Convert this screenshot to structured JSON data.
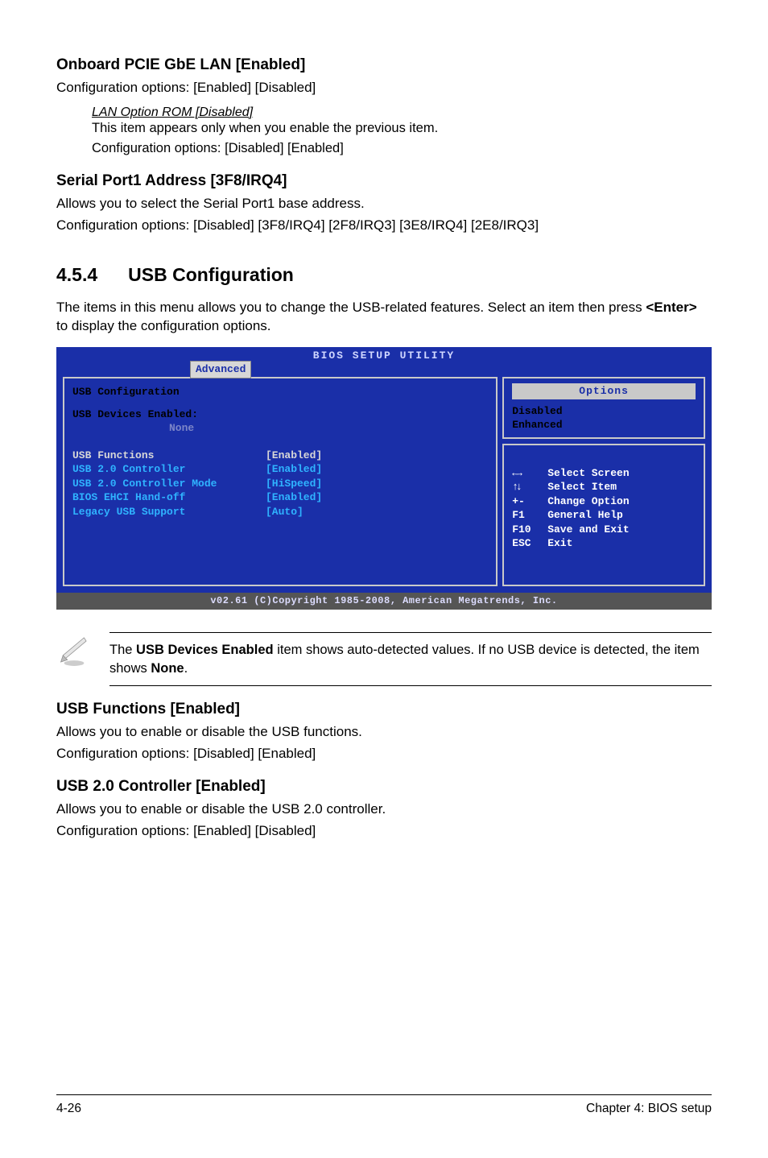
{
  "h_onboard": "Onboard PCIE GbE LAN [Enabled]",
  "h_onboard_opts": "Configuration options: [Enabled] [Disabled]",
  "lan_rom": {
    "title": "LAN Option ROM [Disabled]",
    "line1": "This item appears only when you enable the previous item.",
    "line2": "Configuration options: [Disabled] [Enabled]"
  },
  "h_serial": "Serial Port1 Address [3F8/IRQ4]",
  "serial_line1": "Allows you to select the Serial Port1 base address.",
  "serial_line2": "Configuration options: [Disabled] [3F8/IRQ4] [2F8/IRQ3] [3E8/IRQ4] [2E8/IRQ3]",
  "sec_num": "4.5.4",
  "sec_title": "USB Configuration",
  "sec_intro1": "The items in this menu allows you to change the USB-related features. Select an item then press ",
  "sec_intro_key": "<Enter>",
  "sec_intro2": " to display the configuration options.",
  "bios": {
    "title": "BIOS SETUP UTILITY",
    "tab": "Advanced",
    "left_title": "USB Configuration",
    "dev_label": "USB Devices Enabled:",
    "dev_none": "None",
    "rows": [
      {
        "label": "USB Functions",
        "value": "[Enabled]",
        "sel": true
      },
      {
        "label": "USB 2.0 Controller",
        "value": "[Enabled]",
        "sel": false
      },
      {
        "label": "USB 2.0 Controller Mode",
        "value": "[HiSpeed]",
        "sel": false
      },
      {
        "label": "BIOS EHCI Hand-off",
        "value": "[Enabled]",
        "sel": false
      },
      {
        "label": "Legacy USB Support",
        "value": "[Auto]",
        "sel": false
      }
    ],
    "right_title": "Options",
    "right_opts": [
      "Disabled",
      "Enhanced"
    ],
    "help": [
      {
        "key": "←→",
        "label": "Select Screen"
      },
      {
        "key": "↑↓",
        "label": "Select Item"
      },
      {
        "key": "+-",
        "label": "Change Option"
      },
      {
        "key": "F1",
        "label": "General Help"
      },
      {
        "key": "F10",
        "label": "Save and Exit"
      },
      {
        "key": "ESC",
        "label": "Exit"
      }
    ],
    "footer": "v02.61 (C)Copyright 1985-2008, American Megatrends, Inc."
  },
  "note_pre": "The ",
  "note_b1": "USB Devices Enabled",
  "note_mid": " item shows auto-detected values. If no USB device is detected, the item shows ",
  "note_b2": "None",
  "note_post": ".",
  "h_usb_func": "USB Functions [Enabled]",
  "usb_func_l1": "Allows you to enable or disable the USB functions.",
  "usb_func_l2": "Configuration options: [Disabled] [Enabled]",
  "h_usb20": "USB 2.0 Controller [Enabled]",
  "usb20_l1": "Allows you to enable or disable the USB 2.0 controller.",
  "usb20_l2": "Configuration options: [Enabled] [Disabled]",
  "footer_left": "4-26",
  "footer_right": "Chapter 4: BIOS setup"
}
